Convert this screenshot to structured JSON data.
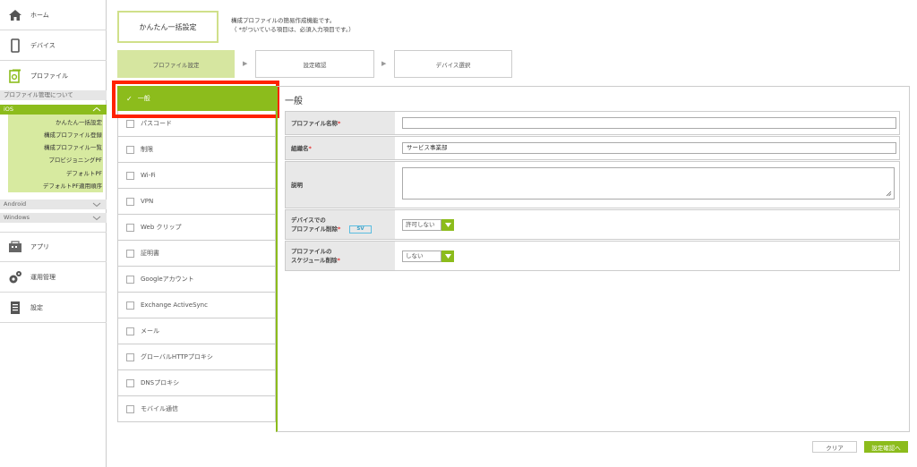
{
  "sidebar": {
    "home": "ホーム",
    "device": "デバイス",
    "profile": "プロファイル",
    "about": "プロファイル管理について",
    "ios": "iOS",
    "ios_items": [
      "かんたん一括設定",
      "構成プロファイル登録",
      "構成プロファイル一覧",
      "プロビジョニングPF",
      "デフォルトPF",
      "デフォルトPF適用順序"
    ],
    "android": "Android",
    "windows": "Windows",
    "app": "アプリ",
    "ops": "運用管理",
    "settings": "設定"
  },
  "header": {
    "title": "かんたん一括設定",
    "desc1": "構成プロファイルの簡易作成機能です。",
    "desc2": "（ *がついている項目は、必須入力項目です。）",
    "steps": [
      "プロファイル設定",
      "設定確認",
      "デバイス選択"
    ]
  },
  "categories": [
    "一般",
    "パスコード",
    "制限",
    "Wi-Fi",
    "VPN",
    "Web クリップ",
    "証明書",
    "Googleアカウント",
    "Exchange ActiveSync",
    "メール",
    "グローバルHTTPプロキシ",
    "DNSプロキシ",
    "モバイル通信"
  ],
  "form": {
    "title": "一般",
    "name_label": "プロファイル名称",
    "name_value": "",
    "org_label": "組織名",
    "org_value": "サービス事業部",
    "desc_label": "説明",
    "delete_label1": "デバイスでの",
    "delete_label2": "プロファイル削除",
    "sv_badge": "SV",
    "delete_value": "許可しない",
    "sched_label1": "プロファイルの",
    "sched_label2": "スケジュール削除",
    "sched_value": "しない",
    "req_mark": "*"
  },
  "buttons": {
    "clear": "クリア",
    "next": "設定確認へ"
  },
  "colors": {
    "accent": "#8cbc1c",
    "highlight": "#ff2200"
  }
}
